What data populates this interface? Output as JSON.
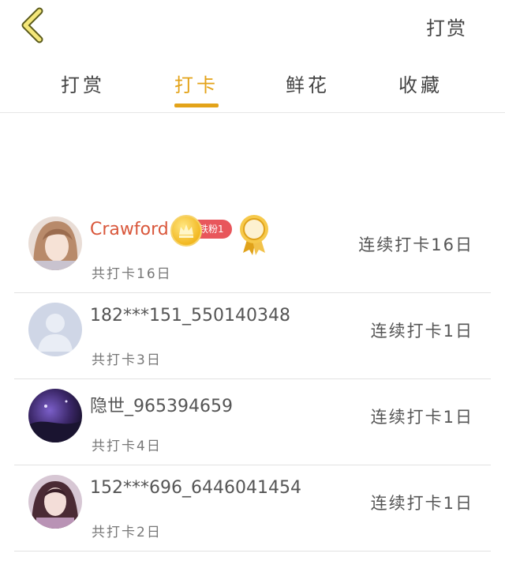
{
  "header": {
    "action_label": "打赏"
  },
  "tabs": [
    {
      "label": "打赏"
    },
    {
      "label": "打卡"
    },
    {
      "label": "鲜花"
    },
    {
      "label": "收藏"
    }
  ],
  "rows": [
    {
      "name": "Crawford",
      "badge": "铁粉1",
      "total": "共打卡16日",
      "streak": "连续打卡16日"
    },
    {
      "name": "182***151_550140348",
      "total": "共打卡3日",
      "streak": "连续打卡1日"
    },
    {
      "name": "隐世_965394659",
      "total": "共打卡4日",
      "streak": "连续打卡1日"
    },
    {
      "name": "152***696_6446041454",
      "total": "共打卡2日",
      "streak": "连续打卡1日"
    }
  ],
  "colors": {
    "accent": "#e3a319",
    "highlight_name": "#d9573b",
    "fan_badge": "#e8565b"
  }
}
